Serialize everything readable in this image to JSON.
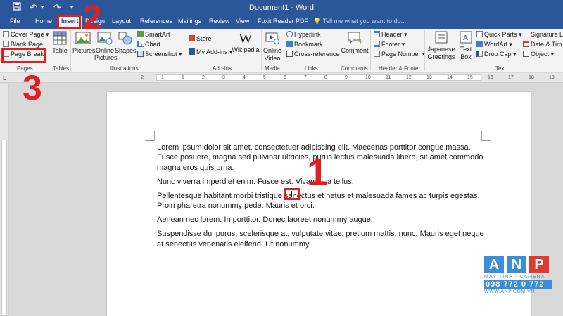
{
  "window": {
    "title": "Document1 - Word",
    "qat": {
      "save_icon": "save-icon",
      "undo_icon": "undo-icon",
      "redo_icon": "redo-icon",
      "customize_icon": "chevron-down-icon"
    }
  },
  "tabs": [
    {
      "label": "File"
    },
    {
      "label": "Home"
    },
    {
      "label": "Insert",
      "active": true
    },
    {
      "label": "Design"
    },
    {
      "label": "Layout"
    },
    {
      "label": "References"
    },
    {
      "label": "Mailings"
    },
    {
      "label": "Review"
    },
    {
      "label": "View"
    },
    {
      "label": "Foxit Reader PDF"
    }
  ],
  "tell_me": "Tell me what you want to do...",
  "ribbon": {
    "pages": {
      "cover_page": "Cover Page",
      "blank_page": "Blank Page",
      "page_break": "Page Break",
      "group": "Pages"
    },
    "tables": {
      "table": "Table",
      "group": "Tables"
    },
    "illustrations": {
      "pictures": "Pictures",
      "online_pictures": "Online Pictures",
      "shapes": "Shapes",
      "smartart": "SmartArt",
      "chart": "Chart",
      "screenshot": "Screenshot",
      "group": "Illustrations"
    },
    "addins": {
      "store": "Store",
      "my_addins": "My Add-ins",
      "wikipedia": "Wikipedia",
      "group": "Add-ins"
    },
    "media": {
      "online_video_1": "Online",
      "online_video_2": "Video",
      "group": "Media"
    },
    "links": {
      "hyperlink": "Hyperlink",
      "bookmark": "Bookmark",
      "cross_reference": "Cross-reference",
      "group": "Links"
    },
    "comments": {
      "comment": "Comment",
      "group": "Comments"
    },
    "header_footer": {
      "header": "Header",
      "footer": "Footer",
      "page_number": "Page Number",
      "group": "Header & Footer"
    },
    "text": {
      "japanese_greetings_1": "Japanese",
      "japanese_greetings_2": "Greetings",
      "text_box_1": "Text",
      "text_box_2": "Box",
      "quick_parts": "Quick Parts",
      "wordart": "WordArt",
      "drop_cap": "Drop Cap",
      "signature_line": "Signature Li",
      "date_time": "Date & Tim",
      "object": "Object",
      "group": "Text"
    }
  },
  "ruler": {
    "numbers": [
      "2",
      "1",
      "1",
      "2",
      "3",
      "4",
      "5",
      "6",
      "7",
      "8",
      "9",
      "10",
      "11",
      "12",
      "13",
      "14",
      "15",
      "16",
      "17",
      "18",
      "19"
    ]
  },
  "document": {
    "paragraphs": [
      "Lorem ipsum dolor sit amet, consectetuer adipiscing elit. Maecenas porttitor congue massa. Fusce posuere, magna sed pulvinar ultricies, purus lectus malesuada libero, sit amet commodo magna eros quis urna.",
      "Nunc viverra imperdiet enim. Fusce est. Vivamus a tellus.",
      "Pellentesque habitant morbi tristique senectus et netus et malesuada fames ac turpis egestas. Proin pharetra nonummy pede. Mauris et orci.",
      "Aenean nec lorem. In porttitor. Donec laoreet nonummy augue.",
      "Suspendisse dui purus, scelerisque at, vulputate vitae, pretium mattis, nunc. Mauris eget neque at senectus venenatis eleifend. Ut nonummy."
    ]
  },
  "callouts": {
    "step1": "1",
    "step2": "2",
    "step3": "3"
  },
  "logo": {
    "brand": "ANP",
    "tagline": "MÁY TÍNH - CAMERA",
    "phone": "098 772 0 772",
    "url": "WWW.ANP.COM.VN",
    "colors": {
      "blue": "#3a8fd8",
      "red": "#e23a2f"
    }
  }
}
